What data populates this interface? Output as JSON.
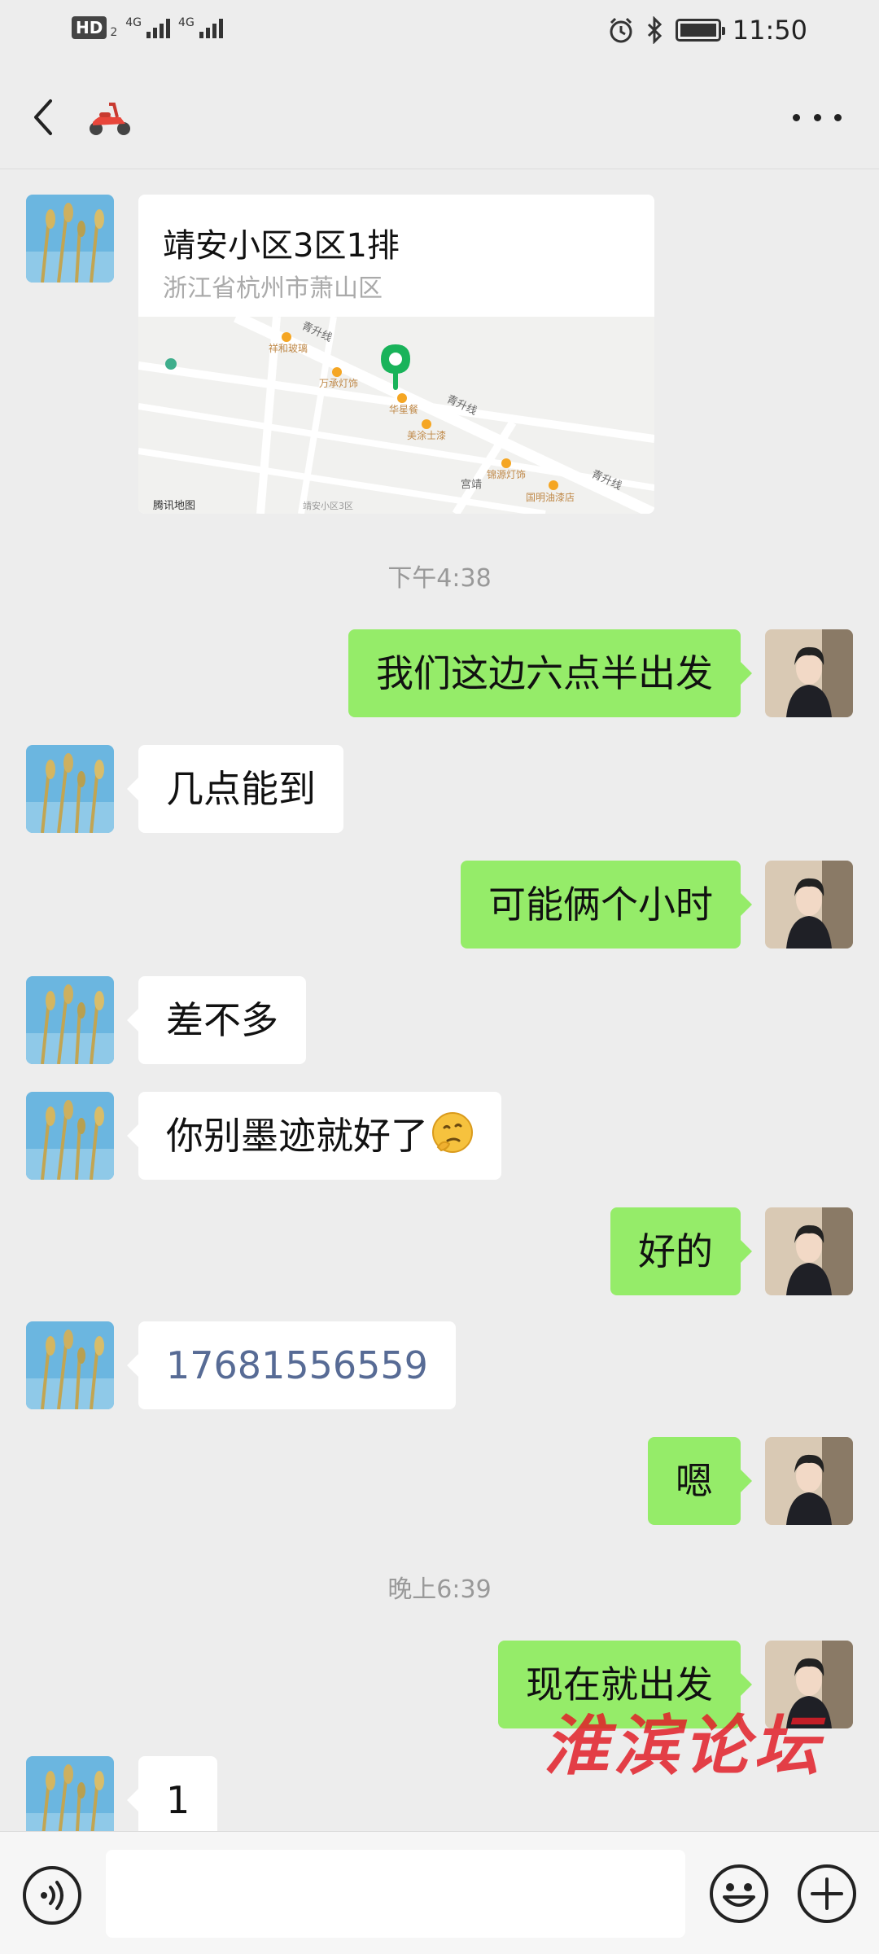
{
  "status_bar": {
    "hd": "HD",
    "hd_sub": "2",
    "net1": "4G",
    "net2": "4G",
    "time": "11:50"
  },
  "header": {
    "contact_icon": "scooter-icon"
  },
  "messages": [
    {
      "type": "location",
      "side": "in",
      "title": "靖安小区3区1排",
      "address": "浙江省杭州市萧山区",
      "map_labels": {
        "road1": "青升线",
        "road2": "青升线",
        "road3": "青升线",
        "road4": "宫靖",
        "poi1": "祥和玻璃",
        "poi2": "万承灯饰",
        "poi3": "华星餐",
        "poi4": "美涂士漆",
        "poi5": "锦源灯饰",
        "poi6": "国明油漆店",
        "brand": "腾讯地图",
        "place": "靖安小区3区"
      }
    },
    {
      "type": "time",
      "text": "下午4:38"
    },
    {
      "type": "text",
      "side": "out",
      "text": "我们这边六点半出发"
    },
    {
      "type": "text",
      "side": "in",
      "text": "几点能到"
    },
    {
      "type": "text",
      "side": "out",
      "text": "可能俩个小时"
    },
    {
      "type": "text",
      "side": "in",
      "text": "差不多"
    },
    {
      "type": "text",
      "side": "in",
      "text": "你别墨迹就好了",
      "emoji": "thinking-face-icon"
    },
    {
      "type": "text",
      "side": "out",
      "text": "好的"
    },
    {
      "type": "text",
      "side": "in",
      "text": "17681556559"
    },
    {
      "type": "text",
      "side": "out",
      "text": "嗯"
    },
    {
      "type": "time",
      "text": "晚上6:39"
    },
    {
      "type": "text",
      "side": "out",
      "text": "现在就出发"
    },
    {
      "type": "text",
      "side": "in",
      "text": "1"
    }
  ],
  "input": {
    "placeholder": ""
  },
  "watermark": "淮滨论坛",
  "colors": {
    "outgoing_bubble": "#95ec69",
    "incoming_bubble": "#ffffff",
    "background": "#ededed",
    "pin": "#19b35a",
    "phone_link": "#576b95"
  }
}
